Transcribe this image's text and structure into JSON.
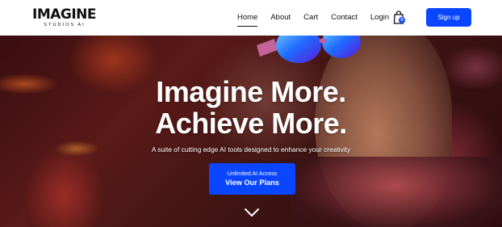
{
  "brand": {
    "name": "IMAGINE",
    "tagline": "STUDIOS AI"
  },
  "nav": {
    "items": [
      {
        "label": "Home",
        "active": true
      },
      {
        "label": "About",
        "active": false
      },
      {
        "label": "Cart",
        "active": false
      },
      {
        "label": "Contact",
        "active": false
      },
      {
        "label": "Login",
        "active": false
      }
    ]
  },
  "cart": {
    "icon": "shopping-bag-icon",
    "count": "0"
  },
  "signup_label": "Sign up",
  "hero": {
    "title_line1": "Imagine More.",
    "title_line2": "Achieve More.",
    "subtitle": "A suite of cutting edge AI tools designed to enhance your creativity",
    "cta_line1": "Unlimited AI Access",
    "cta_line2": "View Our Plans",
    "scroll_icon": "chevron-down-icon"
  },
  "colors": {
    "accent": "#0A46FF",
    "text": "#111111",
    "hero_text": "#FFFFFF"
  }
}
